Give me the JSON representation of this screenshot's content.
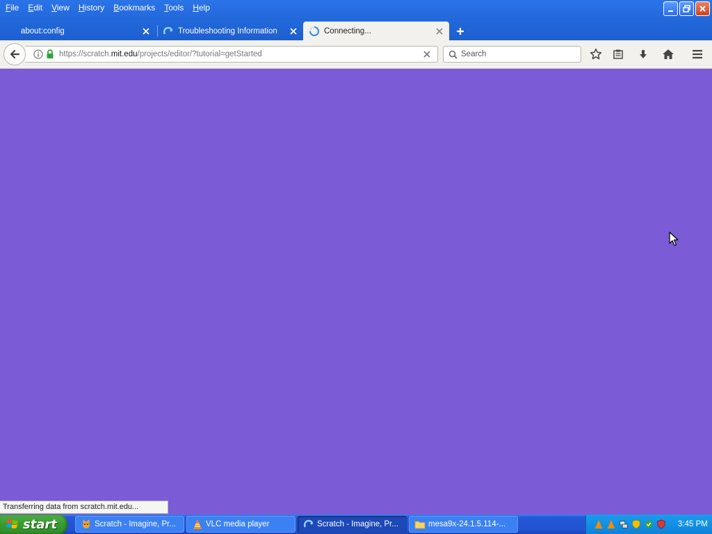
{
  "menubar": {
    "items": [
      {
        "access": "F",
        "rest": "ile"
      },
      {
        "access": "E",
        "rest": "dit"
      },
      {
        "access": "V",
        "rest": "iew"
      },
      {
        "access": "H",
        "rest": "istory"
      },
      {
        "access": "B",
        "rest": "ookmarks"
      },
      {
        "access": "T",
        "rest": "ools"
      },
      {
        "access": "H",
        "rest": "elp"
      }
    ]
  },
  "tabs": [
    {
      "label": "about:config",
      "icon": "none",
      "active": false
    },
    {
      "label": "Troubleshooting Information",
      "icon": "firefox-swirl-icon",
      "active": false
    },
    {
      "label": "Connecting...",
      "icon": "loading-spinner-icon",
      "active": true
    }
  ],
  "navbar": {
    "url_prefix": "https://scratch.",
    "url_host": "mit.edu",
    "url_path": "/projects/editor/?tutorial=getStarted",
    "search_placeholder": "Search"
  },
  "status": {
    "text": "Transferring data from scratch.mit.edu..."
  },
  "taskbar": {
    "start_label": "start",
    "tasks": [
      {
        "label": "Scratch - Imagine, Pr...",
        "icon": "scratch-cat-icon",
        "active": false
      },
      {
        "label": "VLC media player",
        "icon": "vlc-cone-icon",
        "active": false
      },
      {
        "label": "Scratch - Imagine, Pr...",
        "icon": "firefox-swirl-icon",
        "active": true
      },
      {
        "label": "mesa9x-24.1.5.114-...",
        "icon": "folder-icon",
        "active": false
      }
    ],
    "clock": "3:45 PM"
  },
  "colors": {
    "page_background": "#7b5cd6",
    "titlebar": "#2167d9",
    "start_green": "#379c2f",
    "tray_blue": "#1290e5"
  }
}
